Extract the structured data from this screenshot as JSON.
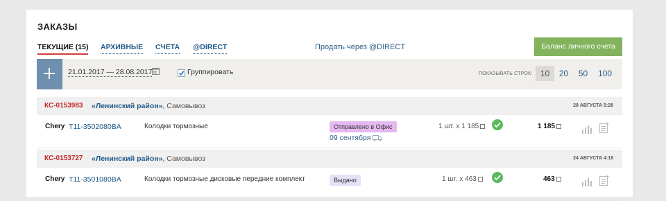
{
  "header": {
    "title": "ЗАКАЗЫ"
  },
  "tabs": [
    {
      "label": "ТЕКУЩИЕ (15)",
      "active": true
    },
    {
      "label": "АРХИВНЫЕ",
      "active": false
    },
    {
      "label": "СЧЕТА",
      "active": false
    },
    {
      "label": "@DIRECT",
      "active": false
    }
  ],
  "sell_link": "Продать через @DIRECT",
  "balance_button": "Баланс личного счета",
  "filters": {
    "date_range": "21.01.2017 — 28.08.2017",
    "group_label": "Группировать",
    "group_checked": true,
    "rows_label": "ПОКАЗЫВАТЬ СТРОК:",
    "page_sizes": [
      "10",
      "20",
      "50",
      "100"
    ],
    "selected_page_size": "10"
  },
  "orders": [
    {
      "number": "КС-0153983",
      "location": "«Ленинский район»",
      "delivery": ", Самовывоз",
      "date": "28 АВГУСТА 5:28",
      "item": {
        "brand": "Chery",
        "article": "T11-3502080BA",
        "description": "Колодки тормозные",
        "status": "Отправлено в Офис",
        "ship_date": "09 сентября",
        "quantity": "1 шт. х 1 185",
        "total": "1 185"
      }
    },
    {
      "number": "КС-0153727",
      "location": "«Ленинский район»",
      "delivery": ", Самовывоз",
      "date": "24 АВГУСТА 4:18",
      "item": {
        "brand": "Chery",
        "article": "T11-3501080BA",
        "description": "Колодки тормозные дисковые передние комплект",
        "status": "Выдано",
        "quantity": "1 шт. х 463",
        "total": "463"
      }
    }
  ],
  "colors": {
    "accent_red": "#c62828",
    "link_blue": "#1f5a8a",
    "balance_green": "#84b35d",
    "add_blue": "#6f8fae",
    "ok_green": "#5cb85c"
  }
}
